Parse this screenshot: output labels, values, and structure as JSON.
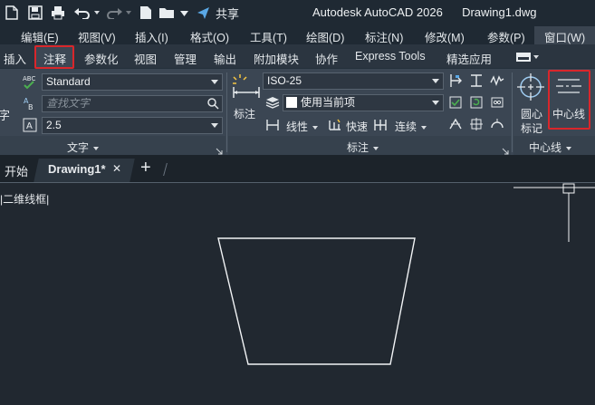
{
  "window": {
    "app_title": "Autodesk AutoCAD 2026",
    "doc_name": "Drawing1.dwg",
    "share_label": "共享"
  },
  "menu": {
    "items": [
      "编辑(E)",
      "视图(V)",
      "插入(I)",
      "格式(O)",
      "工具(T)",
      "绘图(D)",
      "标注(N)",
      "修改(M)",
      "参数(P)",
      "窗口(W)"
    ]
  },
  "ribbon_tabs": {
    "items": [
      "插入",
      "注释",
      "参数化",
      "视图",
      "管理",
      "输出",
      "附加模块",
      "协作",
      "Express Tools",
      "精选应用"
    ],
    "active": "注释"
  },
  "text_panel": {
    "side_label": "字",
    "style_value": "Standard",
    "search_placeholder": "查找文字",
    "height_value": "2.5",
    "title": "文字"
  },
  "dim_panel": {
    "big_button_label": "标注",
    "dimstyle_value": "ISO-25",
    "layer_value": "使用当前项",
    "linear_label": "线性",
    "quick_label": "快速",
    "continue_label": "连续",
    "title": "标注"
  },
  "centerline_panel": {
    "center_mark_label_1": "圆心",
    "center_mark_label_2": "标记",
    "centerline_label": "中心线",
    "title": "中心线"
  },
  "doc_tabs": {
    "start_label": "开始",
    "active_label": "Drawing1*",
    "close_glyph": "✕",
    "new_glyph": "+"
  },
  "viewport": {
    "label": "|二维线框|"
  },
  "colors": {
    "highlight_red": "#d9262b",
    "ribbon_bg": "#3b4653",
    "canvas_bg": "#212830"
  }
}
